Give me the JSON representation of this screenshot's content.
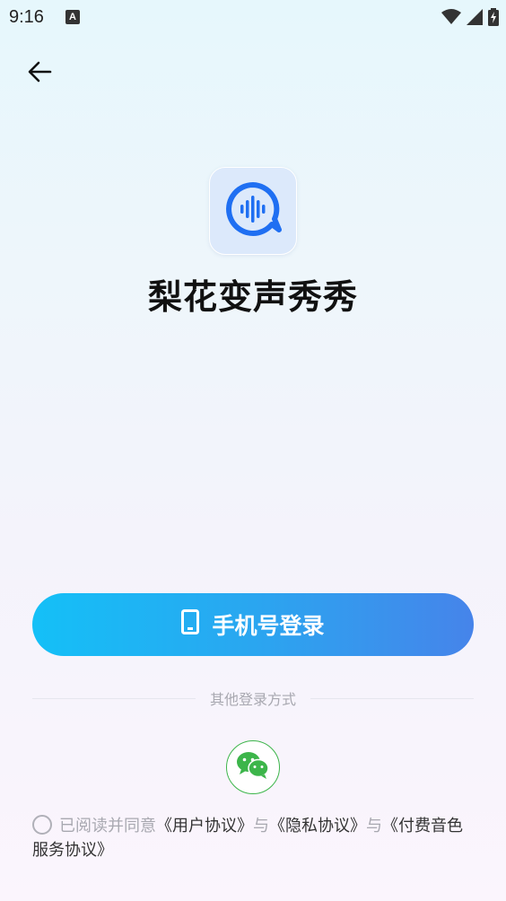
{
  "status_bar": {
    "time": "9:16",
    "notification_letter": "A",
    "icons": [
      "wifi-icon",
      "signal-icon",
      "battery-charging-icon"
    ]
  },
  "header": {
    "back_icon": "arrow-left-icon"
  },
  "app": {
    "name": "梨花变声秀秀",
    "icon": "voice-wave-bubble-icon",
    "icon_color": "#1f6ff2"
  },
  "login": {
    "phone_label": "手机号登录",
    "phone_icon": "phone-icon",
    "other_methods_label": "其他登录方式",
    "wechat_icon": "wechat-icon",
    "gradient_start": "#14c0f7",
    "gradient_end": "#4684ea"
  },
  "agreement": {
    "prefix": "已阅读并同意",
    "user_agreement": "《用户协议》",
    "and1": "与",
    "privacy": "《隐私协议》",
    "and2": "与",
    "paid_voice_prefix": "《付费音色",
    "paid_voice_suffix": "服务协议》",
    "checked": false
  }
}
